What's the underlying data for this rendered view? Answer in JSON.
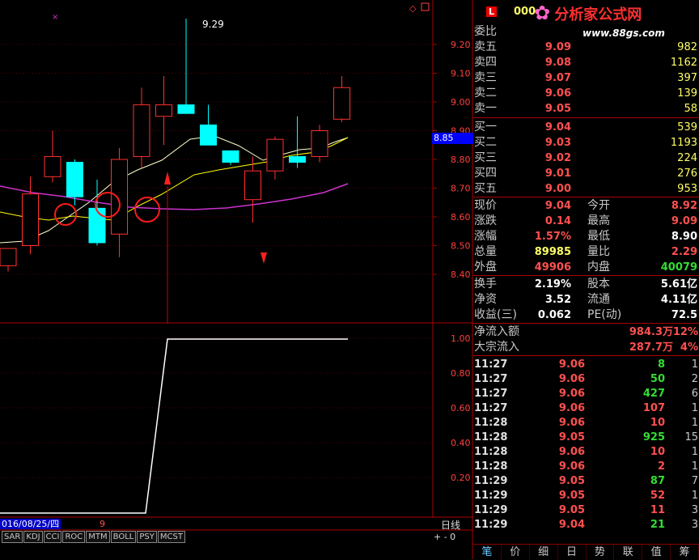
{
  "header": {
    "badge": "L",
    "code": "000"
  },
  "logo": {
    "title": "分析家公式网",
    "url": "www.88gs.com"
  },
  "chart_data": {
    "type": "candlestick",
    "price_axis": [
      "9.20",
      "9.10",
      "9.00",
      "8.90",
      "8.80",
      "8.70",
      "8.60",
      "8.50",
      "8.40"
    ],
    "indicator_axis": [
      "1.00",
      "0.80",
      "0.60",
      "0.40",
      "0.20"
    ],
    "high_label": "9.29",
    "current_tag": "8.85",
    "date_label": "016/08/25/四",
    "tick_label": "9",
    "period": "日线",
    "zoom": "+ - 0",
    "candles": [
      {
        "o": 8.43,
        "c": 8.49,
        "h": 8.49,
        "l": 8.41
      },
      {
        "o": 8.5,
        "c": 8.68,
        "h": 8.74,
        "l": 8.47
      },
      {
        "o": 8.74,
        "c": 8.81,
        "h": 8.9,
        "l": 8.72
      },
      {
        "o": 8.79,
        "c": 8.67,
        "h": 8.8,
        "l": 8.64
      },
      {
        "o": 8.63,
        "c": 8.51,
        "h": 8.73,
        "l": 8.5
      },
      {
        "o": 8.54,
        "c": 8.8,
        "h": 8.84,
        "l": 8.46
      },
      {
        "o": 8.81,
        "c": 8.99,
        "h": 9.05,
        "l": 8.77
      },
      {
        "o": 8.95,
        "c": 8.99,
        "h": 9.09,
        "l": 8.85
      },
      {
        "o": 8.99,
        "c": 8.96,
        "h": 9.29,
        "l": 8.96
      },
      {
        "o": 8.92,
        "c": 8.85,
        "h": 8.99,
        "l": 8.85
      },
      {
        "o": 8.83,
        "c": 8.79,
        "h": 8.83,
        "l": 8.78
      },
      {
        "o": 8.66,
        "c": 8.76,
        "h": 8.81,
        "l": 8.58
      },
      {
        "o": 8.76,
        "c": 8.87,
        "h": 8.88,
        "l": 8.73
      },
      {
        "o": 8.81,
        "c": 8.79,
        "h": 8.95,
        "l": 8.77
      },
      {
        "o": 8.81,
        "c": 8.9,
        "h": 8.92,
        "l": 8.79
      },
      {
        "o": 8.94,
        "c": 9.05,
        "h": 9.09,
        "l": 8.93
      }
    ]
  },
  "indicator_tabs": [
    "SAR",
    "KDJ",
    "CCI",
    "ROC",
    "MTM",
    "BOLL",
    "PSY",
    "MCST"
  ],
  "quote": {
    "weibi_label": "委比",
    "asks": [
      {
        "label": "卖五",
        "price": "9.09",
        "vol": "982"
      },
      {
        "label": "卖四",
        "price": "9.08",
        "vol": "1162"
      },
      {
        "label": "卖三",
        "price": "9.07",
        "vol": "397"
      },
      {
        "label": "卖二",
        "price": "9.06",
        "vol": "139"
      },
      {
        "label": "卖一",
        "price": "9.05",
        "vol": "58"
      }
    ],
    "bids": [
      {
        "label": "买一",
        "price": "9.04",
        "vol": "539"
      },
      {
        "label": "买二",
        "price": "9.03",
        "vol": "1193"
      },
      {
        "label": "买三",
        "price": "9.02",
        "vol": "224"
      },
      {
        "label": "买四",
        "price": "9.01",
        "vol": "276"
      },
      {
        "label": "买五",
        "price": "9.00",
        "vol": "953"
      }
    ],
    "stats1": [
      {
        "l1": "现价",
        "v1": "9.04",
        "c1": "#ff5050",
        "l2": "今开",
        "v2": "8.92",
        "c2": "#ff5050"
      },
      {
        "l1": "涨跌",
        "v1": "0.14",
        "c1": "#ff5050",
        "l2": "最高",
        "v2": "9.09",
        "c2": "#ff5050"
      },
      {
        "l1": "涨幅",
        "v1": "1.57%",
        "c1": "#ff5050",
        "l2": "最低",
        "v2": "8.90",
        "c2": "#ffffff"
      },
      {
        "l1": "总量",
        "v1": "89985",
        "c1": "#ffff66",
        "l2": "量比",
        "v2": "2.29",
        "c2": "#ff5050"
      },
      {
        "l1": "外盘",
        "v1": "49906",
        "c1": "#ff5050",
        "l2": "内盘",
        "v2": "40079",
        "c2": "#33dd33"
      }
    ],
    "stats2": [
      {
        "l1": "换手",
        "v1": "2.19%",
        "l2": "股本",
        "v2": "5.61亿"
      },
      {
        "l1": "净资",
        "v1": "3.52",
        "l2": "流通",
        "v2": "4.11亿"
      },
      {
        "l1": "收益(三)",
        "v1": "0.062",
        "l2": "PE(动)",
        "v2": "72.5"
      }
    ],
    "flows": [
      {
        "label": "净流入额",
        "value": "984.3万",
        "pct": "12%"
      },
      {
        "label": "大宗流入",
        "value": "287.7万",
        "pct": "4%"
      }
    ]
  },
  "ticks": [
    {
      "time": "11:27",
      "price": "9.06",
      "vol": "8",
      "color": "#33dd33",
      "cnt": "1"
    },
    {
      "time": "11:27",
      "price": "9.06",
      "vol": "50",
      "color": "#33dd33",
      "cnt": "2"
    },
    {
      "time": "11:27",
      "price": "9.06",
      "vol": "427",
      "color": "#33dd33",
      "cnt": "6"
    },
    {
      "time": "11:27",
      "price": "9.06",
      "vol": "107",
      "color": "#ff5050",
      "cnt": "1"
    },
    {
      "time": "11:28",
      "price": "9.06",
      "vol": "10",
      "color": "#ff5050",
      "cnt": "1"
    },
    {
      "time": "11:28",
      "price": "9.05",
      "vol": "925",
      "color": "#33dd33",
      "cnt": "15"
    },
    {
      "time": "11:28",
      "price": "9.06",
      "vol": "10",
      "color": "#ff5050",
      "cnt": "1"
    },
    {
      "time": "11:28",
      "price": "9.06",
      "vol": "2",
      "color": "#ff5050",
      "cnt": "1"
    },
    {
      "time": "11:29",
      "price": "9.05",
      "vol": "87",
      "color": "#33dd33",
      "cnt": "7"
    },
    {
      "time": "11:29",
      "price": "9.05",
      "vol": "52",
      "color": "#ff5050",
      "cnt": "1"
    },
    {
      "time": "11:29",
      "price": "9.05",
      "vol": "11",
      "color": "#ff5050",
      "cnt": "3"
    },
    {
      "time": "11:29",
      "price": "9.04",
      "vol": "21",
      "color": "#33dd33",
      "cnt": "3"
    }
  ],
  "bottom_tabs": [
    "笔",
    "价",
    "细",
    "日",
    "势",
    "联",
    "值",
    "筹"
  ]
}
